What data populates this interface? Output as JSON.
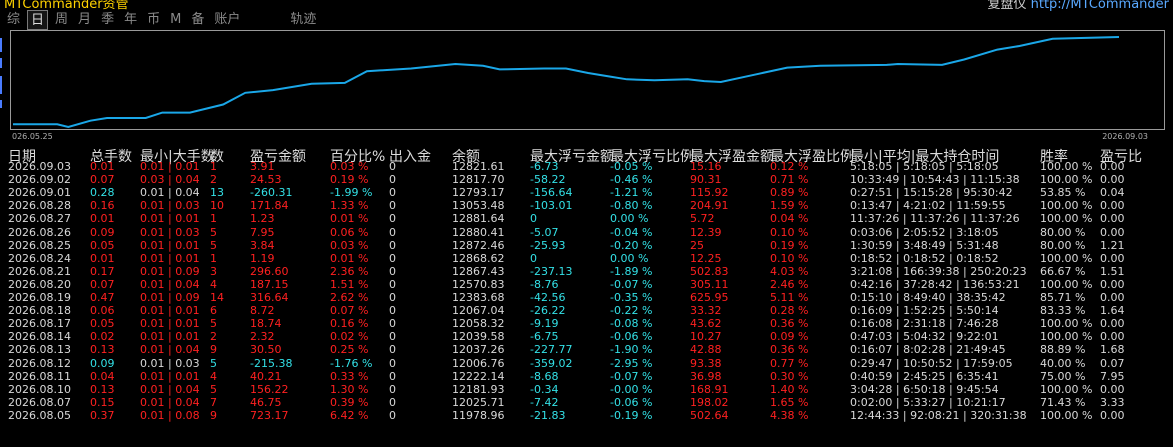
{
  "window": {
    "title_left": "MTCommander资管",
    "title_right_label": "复盘仪",
    "title_right_url": "http://MTCommander"
  },
  "tabs": [
    {
      "label": "综",
      "active": false
    },
    {
      "label": "日",
      "active": true
    },
    {
      "label": "周",
      "active": false
    },
    {
      "label": "月",
      "active": false
    },
    {
      "label": "季",
      "active": false
    },
    {
      "label": "年",
      "active": false
    },
    {
      "label": "币",
      "active": false
    },
    {
      "label": "M",
      "active": false
    },
    {
      "label": "备",
      "active": false
    },
    {
      "label": "账户",
      "active": false
    },
    {
      "label": "轨迹",
      "active": false
    }
  ],
  "chart_data": {
    "type": "line",
    "color": "#1aa7e8",
    "start_label": "026.05.25",
    "end_label": "2026.09.03",
    "values": [
      11978.96,
      11978.96,
      11930,
      12025.71,
      12052,
      12181.93,
      12185,
      12222.14,
      12006.76,
      12037.26,
      12039.58,
      12058.32,
      12067.04,
      12383.68,
      12570.83,
      12867.43,
      12868.62,
      12872.46,
      12880.41,
      12881.64,
      13053.48,
      12793.17,
      12817.7,
      12821.61
    ],
    "points": [
      [
        0,
        0.03
      ],
      [
        0.04,
        0.03
      ],
      [
        0.05,
        0.0
      ],
      [
        0.07,
        0.07
      ],
      [
        0.085,
        0.1
      ],
      [
        0.12,
        0.1
      ],
      [
        0.135,
        0.16
      ],
      [
        0.16,
        0.16
      ],
      [
        0.19,
        0.25
      ],
      [
        0.21,
        0.38
      ],
      [
        0.235,
        0.41
      ],
      [
        0.27,
        0.48
      ],
      [
        0.3,
        0.49
      ],
      [
        0.32,
        0.62
      ],
      [
        0.36,
        0.65
      ],
      [
        0.4,
        0.7
      ],
      [
        0.425,
        0.68
      ],
      [
        0.44,
        0.64
      ],
      [
        0.48,
        0.65
      ],
      [
        0.5,
        0.65
      ],
      [
        0.52,
        0.6
      ],
      [
        0.54,
        0.56
      ],
      [
        0.555,
        0.53
      ],
      [
        0.58,
        0.52
      ],
      [
        0.61,
        0.53
      ],
      [
        0.625,
        0.51
      ],
      [
        0.64,
        0.5
      ],
      [
        0.67,
        0.58
      ],
      [
        0.7,
        0.66
      ],
      [
        0.73,
        0.68
      ],
      [
        0.79,
        0.69
      ],
      [
        0.8,
        0.7
      ],
      [
        0.84,
        0.69
      ],
      [
        0.86,
        0.75
      ],
      [
        0.89,
        0.86
      ],
      [
        0.91,
        0.9
      ],
      [
        0.94,
        0.98
      ],
      [
        1.0,
        1.0
      ]
    ]
  },
  "columns": [
    {
      "label": "日期",
      "key": "date"
    },
    {
      "label": "总手数",
      "key": "total_lots"
    },
    {
      "label": "最小|大手数",
      "key": "min_max_lots"
    },
    {
      "label": "数",
      "key": "count"
    },
    {
      "label": "盈亏金额",
      "key": "pnl"
    },
    {
      "label": "百分比%",
      "key": "pct"
    },
    {
      "label": "出入金",
      "key": "flow"
    },
    {
      "label": "余额",
      "key": "balance"
    },
    {
      "label": "最大浮亏金额",
      "key": "max_float_loss"
    },
    {
      "label": "最大浮亏比例",
      "key": "max_float_loss_pct"
    },
    {
      "label": "最大浮盈金额",
      "key": "max_float_profit"
    },
    {
      "label": "最大浮盈比例",
      "key": "max_float_profit_pct"
    },
    {
      "label": "最小|平均|最大持仓时间",
      "key": "hold_time"
    },
    {
      "label": "胜率",
      "key": "win_rate"
    },
    {
      "label": "盈亏比",
      "key": "pl_ratio"
    }
  ],
  "rows": [
    {
      "date": "2026.09.03",
      "total_lots": "0.01",
      "min_max_lots": "0.01 | 0.01",
      "count": "1",
      "pnl": "3.91",
      "pct": "0.03 %",
      "flow": "0",
      "balance": "12821.61",
      "max_float_loss": "-6.73",
      "max_float_loss_pct": "-0.05 %",
      "max_float_profit": "15.16",
      "max_float_profit_pct": "0.12 %",
      "hold_time": "5:18:05 | 5:18:05 | 5:18:05",
      "win_rate": "100.00 %",
      "pl_ratio": "0.00",
      "tone": "r"
    },
    {
      "date": "2026.09.02",
      "total_lots": "0.07",
      "min_max_lots": "0.03 | 0.04",
      "count": "2",
      "pnl": "24.53",
      "pct": "0.19 %",
      "flow": "0",
      "balance": "12817.70",
      "max_float_loss": "-58.22",
      "max_float_loss_pct": "-0.46 %",
      "max_float_profit": "90.31",
      "max_float_profit_pct": "0.71 %",
      "hold_time": "10:33:49 | 10:54:43 | 11:15:38",
      "win_rate": "100.00 %",
      "pl_ratio": "0.00",
      "tone": "r"
    },
    {
      "date": "2026.09.01",
      "total_lots": "0.28",
      "min_max_lots": "0.01 | 0.04",
      "count": "13",
      "pnl": "-260.31",
      "pct": "-1.99 %",
      "flow": "0",
      "balance": "12793.17",
      "max_float_loss": "-156.64",
      "max_float_loss_pct": "-1.21 %",
      "max_float_profit": "115.92",
      "max_float_profit_pct": "0.89 %",
      "hold_time": "0:27:51 | 15:15:28 | 95:30:42",
      "win_rate": "53.85 %",
      "pl_ratio": "0.04",
      "tone": "c"
    },
    {
      "date": "2026.08.28",
      "total_lots": "0.16",
      "min_max_lots": "0.01 | 0.03",
      "count": "10",
      "pnl": "171.84",
      "pct": "1.33 %",
      "flow": "0",
      "balance": "13053.48",
      "max_float_loss": "-103.01",
      "max_float_loss_pct": "-0.80 %",
      "max_float_profit": "204.91",
      "max_float_profit_pct": "1.59 %",
      "hold_time": "0:13:47 | 4:21:02 | 11:59:55",
      "win_rate": "100.00 %",
      "pl_ratio": "0.00",
      "tone": "r"
    },
    {
      "date": "2026.08.27",
      "total_lots": "0.01",
      "min_max_lots": "0.01 | 0.01",
      "count": "1",
      "pnl": "1.23",
      "pct": "0.01 %",
      "flow": "0",
      "balance": "12881.64",
      "max_float_loss": "0",
      "max_float_loss_pct": "0.00 %",
      "max_float_profit": "5.72",
      "max_float_profit_pct": "0.04 %",
      "hold_time": "11:37:26 | 11:37:26 | 11:37:26",
      "win_rate": "100.00 %",
      "pl_ratio": "0.00",
      "tone": "r"
    },
    {
      "date": "2026.08.26",
      "total_lots": "0.09",
      "min_max_lots": "0.01 | 0.03",
      "count": "5",
      "pnl": "7.95",
      "pct": "0.06 %",
      "flow": "0",
      "balance": "12880.41",
      "max_float_loss": "-5.07",
      "max_float_loss_pct": "-0.04 %",
      "max_float_profit": "12.39",
      "max_float_profit_pct": "0.10 %",
      "hold_time": "0:03:06 | 2:05:52 | 3:18:05",
      "win_rate": "80.00 %",
      "pl_ratio": "0.00",
      "tone": "r"
    },
    {
      "date": "2026.08.25",
      "total_lots": "0.05",
      "min_max_lots": "0.01 | 0.01",
      "count": "5",
      "pnl": "3.84",
      "pct": "0.03 %",
      "flow": "0",
      "balance": "12872.46",
      "max_float_loss": "-25.93",
      "max_float_loss_pct": "-0.20 %",
      "max_float_profit": "25",
      "max_float_profit_pct": "0.19 %",
      "hold_time": "1:30:59 | 3:48:49 | 5:31:48",
      "win_rate": "80.00 %",
      "pl_ratio": "1.21",
      "tone": "r"
    },
    {
      "date": "2026.08.24",
      "total_lots": "0.01",
      "min_max_lots": "0.01 | 0.01",
      "count": "1",
      "pnl": "1.19",
      "pct": "0.01 %",
      "flow": "0",
      "balance": "12868.62",
      "max_float_loss": "0",
      "max_float_loss_pct": "0.00 %",
      "max_float_profit": "12.25",
      "max_float_profit_pct": "0.10 %",
      "hold_time": "0:18:52 | 0:18:52 | 0:18:52",
      "win_rate": "100.00 %",
      "pl_ratio": "0.00",
      "tone": "r"
    },
    {
      "date": "2026.08.21",
      "total_lots": "0.17",
      "min_max_lots": "0.01 | 0.09",
      "count": "3",
      "pnl": "296.60",
      "pct": "2.36 %",
      "flow": "0",
      "balance": "12867.43",
      "max_float_loss": "-237.13",
      "max_float_loss_pct": "-1.89 %",
      "max_float_profit": "502.83",
      "max_float_profit_pct": "4.03 %",
      "hold_time": "3:21:08 | 166:39:38 | 250:20:23",
      "win_rate": "66.67 %",
      "pl_ratio": "1.51",
      "tone": "r"
    },
    {
      "date": "2026.08.20",
      "total_lots": "0.07",
      "min_max_lots": "0.01 | 0.04",
      "count": "4",
      "pnl": "187.15",
      "pct": "1.51 %",
      "flow": "0",
      "balance": "12570.83",
      "max_float_loss": "-8.76",
      "max_float_loss_pct": "-0.07 %",
      "max_float_profit": "305.11",
      "max_float_profit_pct": "2.46 %",
      "hold_time": "0:42:16 | 37:28:42 | 136:53:21",
      "win_rate": "100.00 %",
      "pl_ratio": "0.00",
      "tone": "r"
    },
    {
      "date": "2026.08.19",
      "total_lots": "0.47",
      "min_max_lots": "0.01 | 0.09",
      "count": "14",
      "pnl": "316.64",
      "pct": "2.62 %",
      "flow": "0",
      "balance": "12383.68",
      "max_float_loss": "-42.56",
      "max_float_loss_pct": "-0.35 %",
      "max_float_profit": "625.95",
      "max_float_profit_pct": "5.11 %",
      "hold_time": "0:15:10 | 8:49:40 | 38:35:42",
      "win_rate": "85.71 %",
      "pl_ratio": "0.00",
      "tone": "r"
    },
    {
      "date": "2026.08.18",
      "total_lots": "0.06",
      "min_max_lots": "0.01 | 0.01",
      "count": "6",
      "pnl": "8.72",
      "pct": "0.07 %",
      "flow": "0",
      "balance": "12067.04",
      "max_float_loss": "-26.22",
      "max_float_loss_pct": "-0.22 %",
      "max_float_profit": "33.32",
      "max_float_profit_pct": "0.28 %",
      "hold_time": "0:16:09 | 1:52:25 | 5:50:14",
      "win_rate": "83.33 %",
      "pl_ratio": "1.64",
      "tone": "r"
    },
    {
      "date": "2026.08.17",
      "total_lots": "0.05",
      "min_max_lots": "0.01 | 0.01",
      "count": "5",
      "pnl": "18.74",
      "pct": "0.16 %",
      "flow": "0",
      "balance": "12058.32",
      "max_float_loss": "-9.19",
      "max_float_loss_pct": "-0.08 %",
      "max_float_profit": "43.62",
      "max_float_profit_pct": "0.36 %",
      "hold_time": "0:16:08 | 2:31:18 | 7:46:28",
      "win_rate": "100.00 %",
      "pl_ratio": "0.00",
      "tone": "r"
    },
    {
      "date": "2026.08.14",
      "total_lots": "0.02",
      "min_max_lots": "0.01 | 0.01",
      "count": "2",
      "pnl": "2.32",
      "pct": "0.02 %",
      "flow": "0",
      "balance": "12039.58",
      "max_float_loss": "-6.75",
      "max_float_loss_pct": "-0.06 %",
      "max_float_profit": "10.27",
      "max_float_profit_pct": "0.09 %",
      "hold_time": "0:47:03 | 5:04:32 | 9:22:01",
      "win_rate": "100.00 %",
      "pl_ratio": "0.00",
      "tone": "r"
    },
    {
      "date": "2026.08.13",
      "total_lots": "0.13",
      "min_max_lots": "0.01 | 0.04",
      "count": "9",
      "pnl": "30.50",
      "pct": "0.25 %",
      "flow": "0",
      "balance": "12037.26",
      "max_float_loss": "-227.77",
      "max_float_loss_pct": "-1.90 %",
      "max_float_profit": "42.88",
      "max_float_profit_pct": "0.36 %",
      "hold_time": "0:16:07 | 8:02:28 | 21:49:45",
      "win_rate": "88.89 %",
      "pl_ratio": "1.68",
      "tone": "r"
    },
    {
      "date": "2026.08.12",
      "total_lots": "0.09",
      "min_max_lots": "0.01 | 0.03",
      "count": "5",
      "pnl": "-215.38",
      "pct": "-1.76 %",
      "flow": "0",
      "balance": "12006.76",
      "max_float_loss": "-359.02",
      "max_float_loss_pct": "-2.95 %",
      "max_float_profit": "93.38",
      "max_float_profit_pct": "0.77 %",
      "hold_time": "0:29:47 | 10:50:52 | 17:59:05",
      "win_rate": "40.00 %",
      "pl_ratio": "0.07",
      "tone": "c"
    },
    {
      "date": "2026.08.11",
      "total_lots": "0.04",
      "min_max_lots": "0.01 | 0.01",
      "count": "4",
      "pnl": "40.21",
      "pct": "0.33 %",
      "flow": "0",
      "balance": "12222.14",
      "max_float_loss": "-8.68",
      "max_float_loss_pct": "-0.07 %",
      "max_float_profit": "36.98",
      "max_float_profit_pct": "0.30 %",
      "hold_time": "0:40:59 | 2:45:25 | 6:35:41",
      "win_rate": "75.00 %",
      "pl_ratio": "7.95",
      "tone": "r"
    },
    {
      "date": "2026.08.10",
      "total_lots": "0.13",
      "min_max_lots": "0.01 | 0.04",
      "count": "5",
      "pnl": "156.22",
      "pct": "1.30 %",
      "flow": "0",
      "balance": "12181.93",
      "max_float_loss": "-0.34",
      "max_float_loss_pct": "-0.00 %",
      "max_float_profit": "168.91",
      "max_float_profit_pct": "1.40 %",
      "hold_time": "3:04:28 | 6:50:18 | 9:45:54",
      "win_rate": "100.00 %",
      "pl_ratio": "0.00",
      "tone": "r"
    },
    {
      "date": "2026.08.07",
      "total_lots": "0.15",
      "min_max_lots": "0.01 | 0.04",
      "count": "7",
      "pnl": "46.75",
      "pct": "0.39 %",
      "flow": "0",
      "balance": "12025.71",
      "max_float_loss": "-7.42",
      "max_float_loss_pct": "-0.06 %",
      "max_float_profit": "198.02",
      "max_float_profit_pct": "1.65 %",
      "hold_time": "0:02:00 | 5:33:27 | 10:21:17",
      "win_rate": "71.43 %",
      "pl_ratio": "3.33",
      "tone": "r"
    },
    {
      "date": "2026.08.05",
      "total_lots": "0.37",
      "min_max_lots": "0.01 | 0.08",
      "count": "9",
      "pnl": "723.17",
      "pct": "6.42 %",
      "flow": "0",
      "balance": "11978.96",
      "max_float_loss": "-21.83",
      "max_float_loss_pct": "-0.19 %",
      "max_float_profit": "502.64",
      "max_float_profit_pct": "4.38 %",
      "hold_time": "12:44:33 | 92:08:21 | 320:31:38",
      "win_rate": "100.00 %",
      "pl_ratio": "0.00",
      "tone": "r"
    }
  ]
}
